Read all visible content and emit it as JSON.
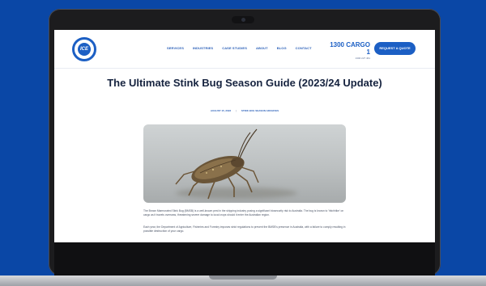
{
  "site": {
    "logo_text": "ICE",
    "nav": [
      "SERVICES",
      "INDUSTRIES",
      "CASE STUDIES",
      "ABOUT",
      "BLOG",
      "CONTACT"
    ],
    "phone": "1300 CARGO 1",
    "phone_sub": "1300 227 461",
    "cta": "REQUEST A QUOTE"
  },
  "article": {
    "title": "The Ultimate Stink Bug Season Guide (2023/24 Update)",
    "date": "AUGUST 15, 2023",
    "category": "STINK BUG SEASON ARCHIVES",
    "separator": "|",
    "paragraphs": [
      "The Brown Marmorated Stink Bug (BMSB) is a well-known pest in the shipping industry posing a significant biosecurity risk to Australia. The bug is known to 'hitchhike' on cargo as it travels overseas, threatening severe damage to local crops should it enter the Australian region.",
      "Each year, the Department of Agriculture, Fisheries and Forestry imposes strict regulations to prevent the BMSB's presence in Australia, with a failure to comply resulting in possible destruction of your cargo."
    ]
  },
  "colors": {
    "background": "#0a47a6",
    "brand": "#1c5fc4",
    "title": "#16233f"
  },
  "icons": [
    "ice-logo-icon",
    "stink-bug-image"
  ]
}
